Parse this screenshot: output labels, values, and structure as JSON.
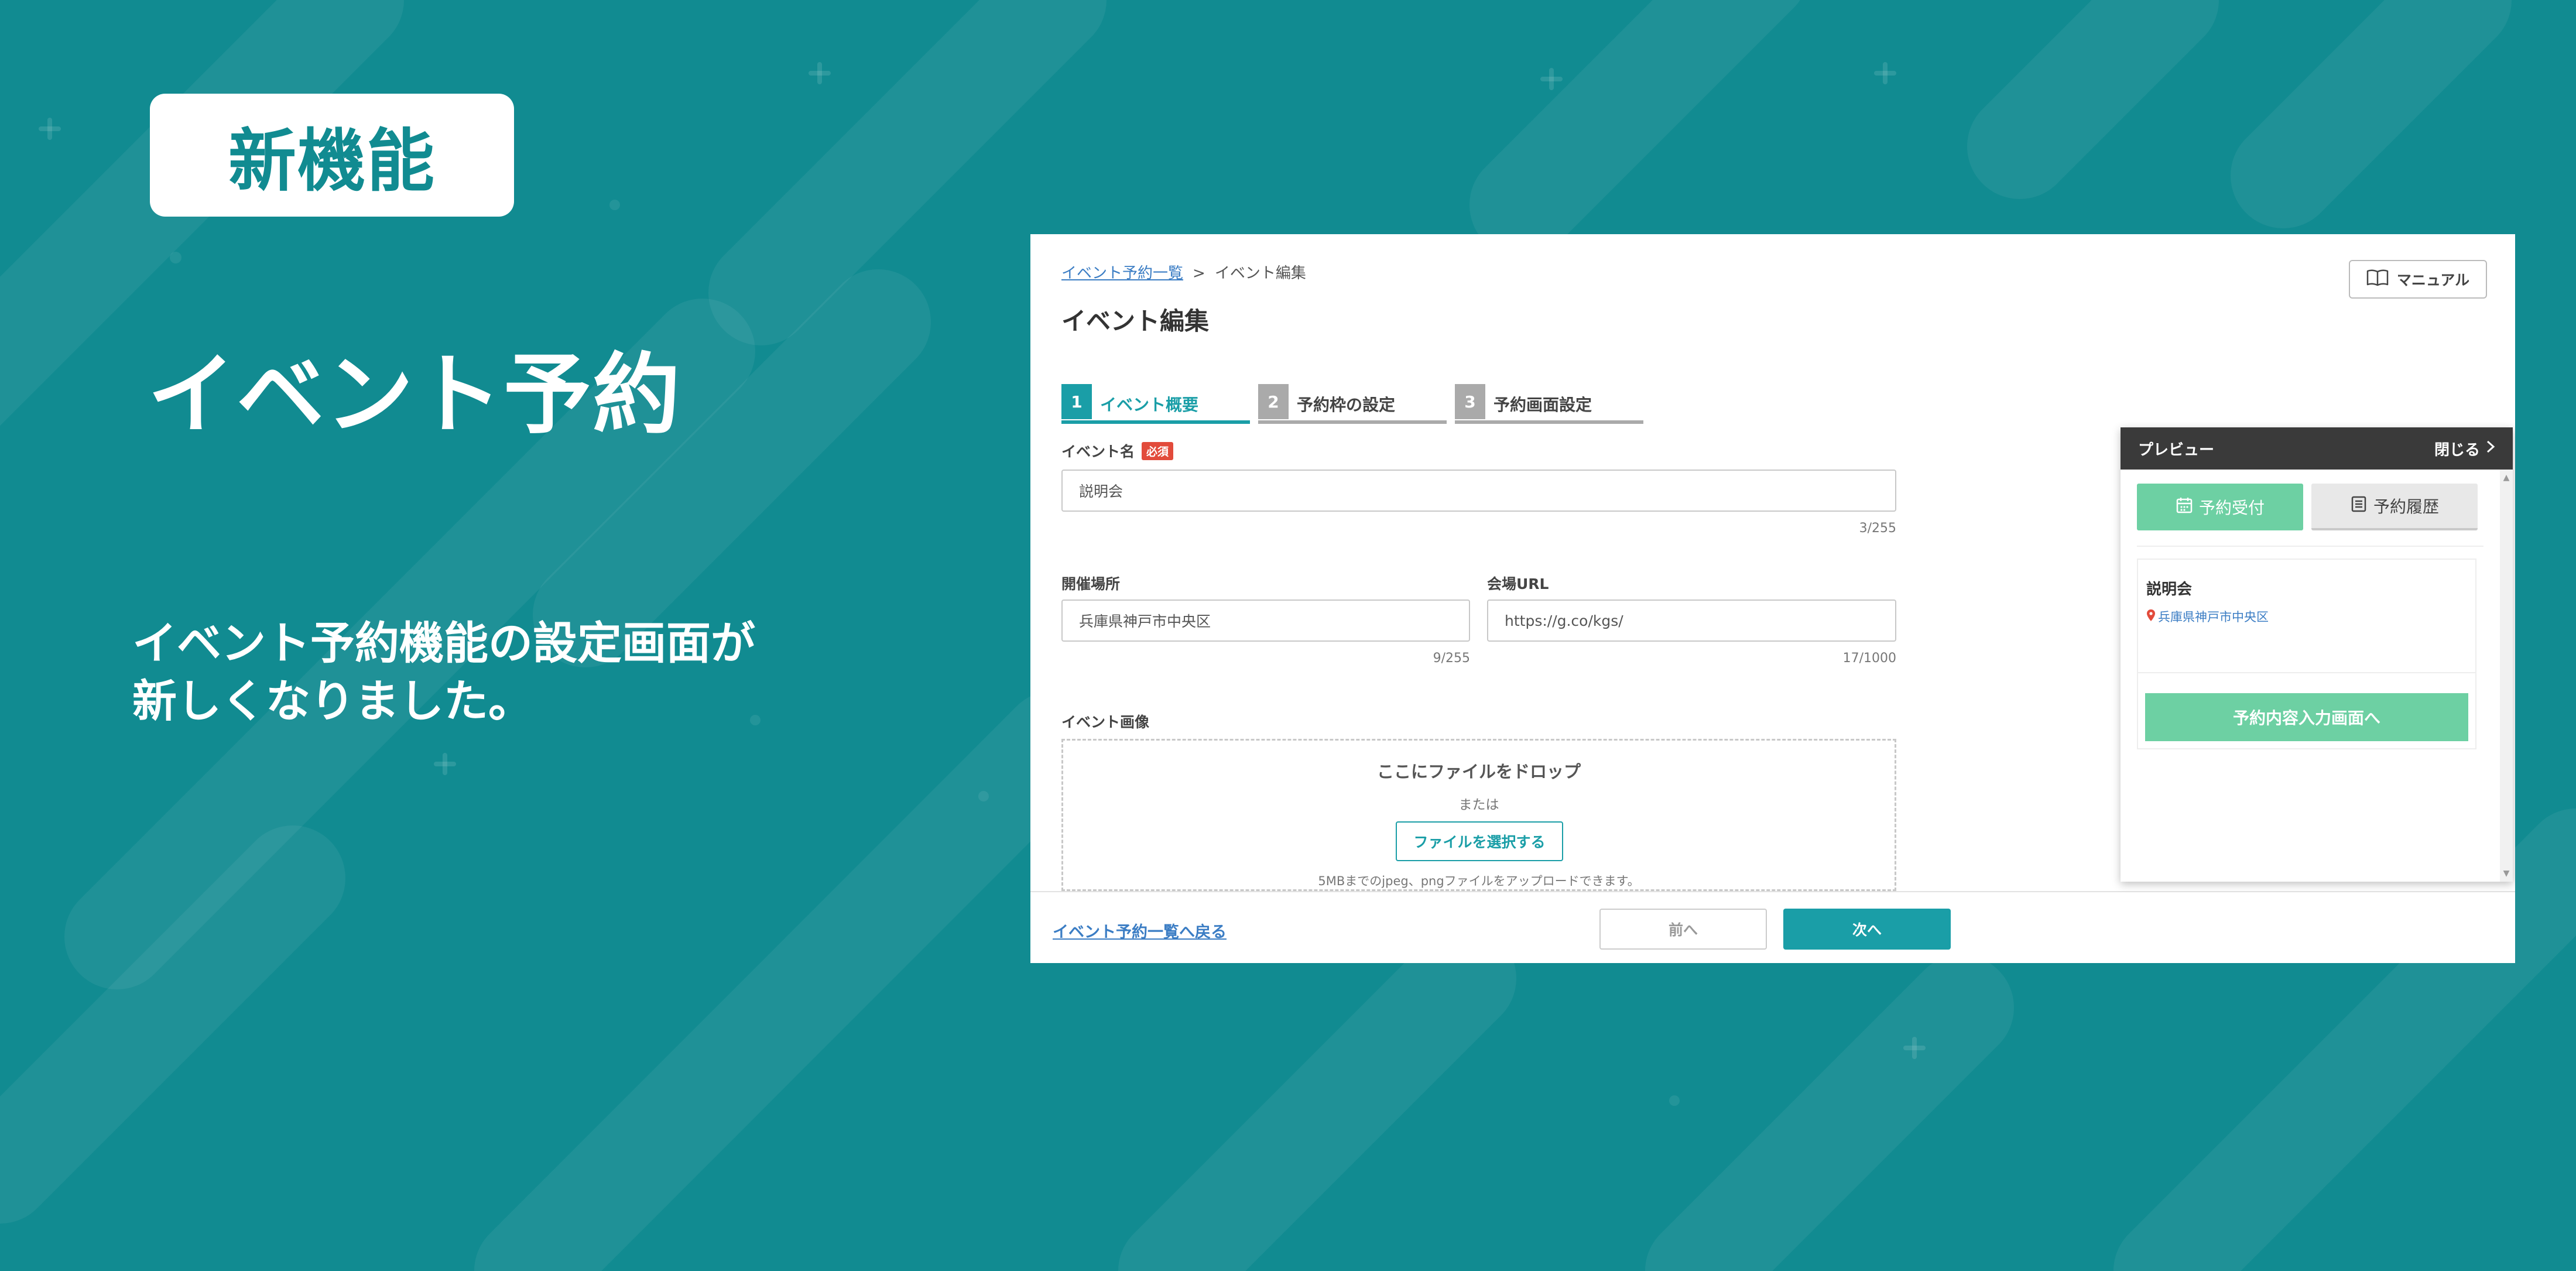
{
  "colors": {
    "background": "#118b91",
    "accent": "#1a9ea7",
    "preview_green": "#6dd0a3",
    "required_red": "#e24b3b",
    "link_blue": "#3b7dc4"
  },
  "promo": {
    "badge": "新機能",
    "title": "イベント予約",
    "description_line1": "イベント予約機能の設定画面が",
    "description_line2": "新しくなりました。"
  },
  "app": {
    "breadcrumb": {
      "parent": "イベント予約一覧",
      "separator": ">",
      "current": "イベント編集"
    },
    "page_title": "イベント編集",
    "manual_button": {
      "label": "マニュアル",
      "icon": "book-icon"
    },
    "steps": [
      {
        "number": "1",
        "label": "イベント概要",
        "state": "active"
      },
      {
        "number": "2",
        "label": "予約枠の設定",
        "state": "inactive"
      },
      {
        "number": "3",
        "label": "予約画面設定",
        "state": "inactive"
      }
    ],
    "form": {
      "event_name": {
        "label": "イベント名",
        "required_badge": "必須",
        "value": "説明会",
        "counter": "3/255"
      },
      "venue": {
        "label": "開催場所",
        "value": "兵庫県神戸市中央区",
        "counter": "9/255"
      },
      "venue_url": {
        "label": "会場URL",
        "value": "https://g.co/kgs/",
        "counter": "17/1000"
      },
      "event_image": {
        "label": "イベント画像",
        "drop_title": "ここにファイルをドロップ",
        "or_text": "または",
        "select_button": "ファイルを選択する",
        "note": "5MBまでのjpeg、pngファイルをアップロードできます。"
      }
    },
    "footer": {
      "back_link": "イベント予約一覧へ戻る",
      "prev_button": "前へ",
      "next_button": "次へ"
    },
    "preview": {
      "title": "プレビュー",
      "close": "閉じる",
      "tabs": [
        {
          "label": "予約受付",
          "icon": "calendar-icon",
          "state": "active"
        },
        {
          "label": "予約履歴",
          "icon": "list-icon",
          "state": "inactive"
        }
      ],
      "card": {
        "title": "説明会",
        "place": "兵庫県神戸市中央区",
        "place_icon": "map-pin-icon",
        "button": "予約内容入力画面へ"
      }
    }
  }
}
